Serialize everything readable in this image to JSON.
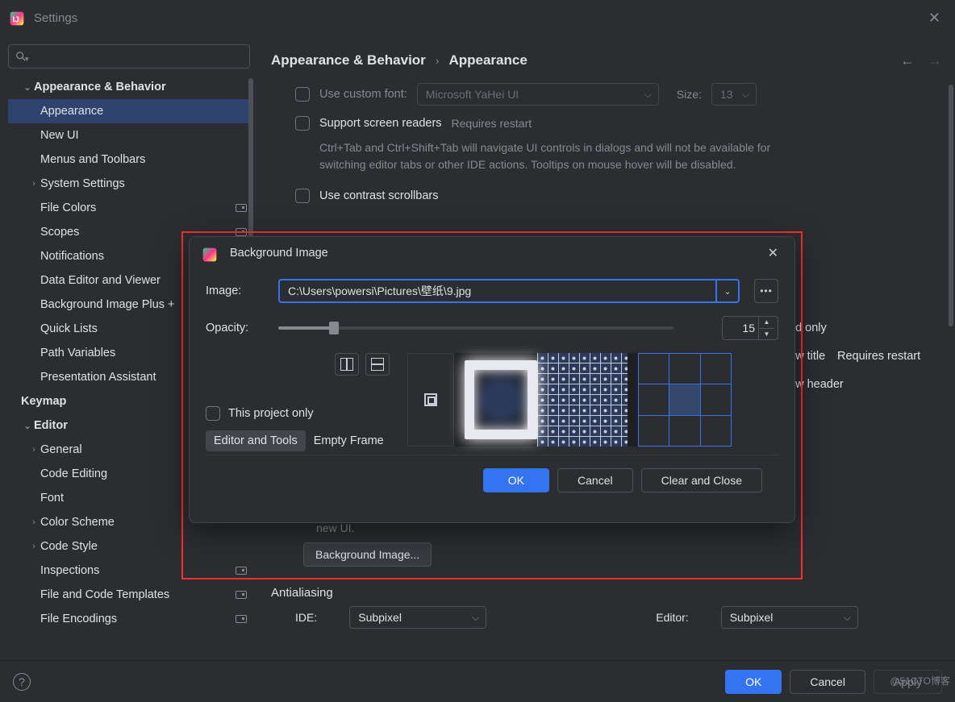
{
  "window": {
    "title": "Settings"
  },
  "breadcrumb": {
    "part1": "Appearance & Behavior",
    "sep": "›",
    "part2": "Appearance"
  },
  "sidebar": {
    "items": [
      {
        "label": "Appearance & Behavior",
        "lvl": 0,
        "chev": "⌄"
      },
      {
        "label": "Appearance",
        "lvl": 1,
        "selected": true
      },
      {
        "label": "New UI",
        "lvl": 1
      },
      {
        "label": "Menus and Toolbars",
        "lvl": 1
      },
      {
        "label": "System Settings",
        "lvl": 1,
        "chev": "›"
      },
      {
        "label": "File Colors",
        "lvl": 1,
        "badge": true
      },
      {
        "label": "Scopes",
        "lvl": 1,
        "badge": true
      },
      {
        "label": "Notifications",
        "lvl": 1
      },
      {
        "label": "Data Editor and Viewer",
        "lvl": 1
      },
      {
        "label": "Background Image Plus +",
        "lvl": 1
      },
      {
        "label": "Quick Lists",
        "lvl": 1
      },
      {
        "label": "Path Variables",
        "lvl": 1
      },
      {
        "label": "Presentation Assistant",
        "lvl": 1
      },
      {
        "label": "Keymap",
        "lvl": 0
      },
      {
        "label": "Editor",
        "lvl": 0,
        "chev": "⌄"
      },
      {
        "label": "General",
        "lvl": 1,
        "chev": "›"
      },
      {
        "label": "Code Editing",
        "lvl": 1
      },
      {
        "label": "Font",
        "lvl": 1
      },
      {
        "label": "Color Scheme",
        "lvl": 1,
        "chev": "›"
      },
      {
        "label": "Code Style",
        "lvl": 1,
        "chev": "›"
      },
      {
        "label": "Inspections",
        "lvl": 1,
        "badge": true
      },
      {
        "label": "File and Code Templates",
        "lvl": 1,
        "badge": true
      },
      {
        "label": "File Encodings",
        "lvl": 1,
        "badge": true
      }
    ]
  },
  "options": {
    "custom_font": "Use custom font:",
    "font_value": "Microsoft YaHei UI",
    "size_lbl": "Size:",
    "size_val": "13",
    "screen_readers": "Support screen readers",
    "requires_restart": "Requires restart",
    "screen_readers_hint": "Ctrl+Tab and Ctrl+Shift+Tab will navigate UI controls in dialogs and will not be available for switching editor tabs or other IDE actions. Tooltips on mouse hover will be disabled.",
    "contrast": "Use contrast scrollbars",
    "partial1": "ed only",
    "partial2": "ow title",
    "partial3": "ow header",
    "newui_note": "new UI.",
    "bg_btn": "Background Image...",
    "antialiasing": "Antialiasing",
    "ide_lbl": "IDE:",
    "editor_lbl": "Editor:",
    "subpixel": "Subpixel"
  },
  "dialog": {
    "title": "Background Image",
    "image_lbl": "Image:",
    "image_path": "C:\\Users\\powersi\\Pictures\\壁纸\\9.jpg",
    "opacity_lbl": "Opacity:",
    "opacity_val": "15",
    "project_only": "This project only",
    "tab1": "Editor and Tools",
    "tab2": "Empty Frame",
    "ok": "OK",
    "cancel": "Cancel",
    "clear": "Clear and Close"
  },
  "footer": {
    "ok": "OK",
    "cancel": "Cancel",
    "apply": "Apply"
  },
  "watermark": "@51CTO博客"
}
